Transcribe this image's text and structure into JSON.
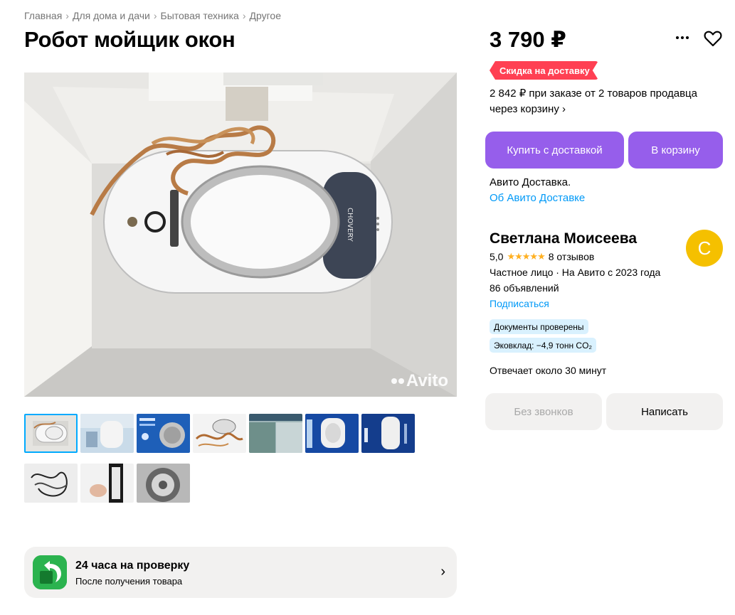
{
  "breadcrumb": [
    {
      "label": "Главная"
    },
    {
      "label": "Для дома и дачи"
    },
    {
      "label": "Бытовая техника"
    },
    {
      "label": "Другое"
    }
  ],
  "breadcrumb_separator": "›",
  "title": "Робот мойщик окон",
  "photo": {
    "watermark": "Avito",
    "device_brand": "CHOVERY",
    "thumbnail_count": 10,
    "active_thumbnail": 1
  },
  "check_banner": {
    "title": "24 часа на проверку",
    "subtitle": "После получения товара",
    "icon": "return-arrow-icon",
    "chevron": "›"
  },
  "price": "3 790 ₽",
  "discount": {
    "badge": "Скидка на доставку",
    "text": "2 842 ₽ при заказе от 2 товаров продавца",
    "link": "через корзину ›"
  },
  "buttons": {
    "buy": "Купить с доставкой",
    "cart": "В корзину",
    "no_calls": "Без звонков",
    "write": "Написать"
  },
  "delivery": {
    "label": "Авито Доставка.",
    "link": "Об Авито Доставке"
  },
  "seller": {
    "name": "Светлана Моисеева",
    "avatar_letter": "С",
    "rating": "5,0",
    "stars": "★★★★★",
    "reviews": "8 отзывов",
    "type": "Частное лицо · На Авито с 2023 года",
    "ads": "86 объявлений",
    "subscribe": "Подписаться",
    "tags": {
      "docs": "Документы проверены",
      "eco": "Эковклад: −4,9 тонн CO₂"
    },
    "response": "Отвечает около 30 минут"
  },
  "colors": {
    "accent_purple": "#965eeb",
    "link_blue": "#0099f7",
    "discount_red": "#ff4053",
    "avatar_yellow": "#f5c000",
    "star_orange": "#ffb021",
    "tag_blue": "#d9f1fe",
    "check_green": "#2bb34f"
  }
}
